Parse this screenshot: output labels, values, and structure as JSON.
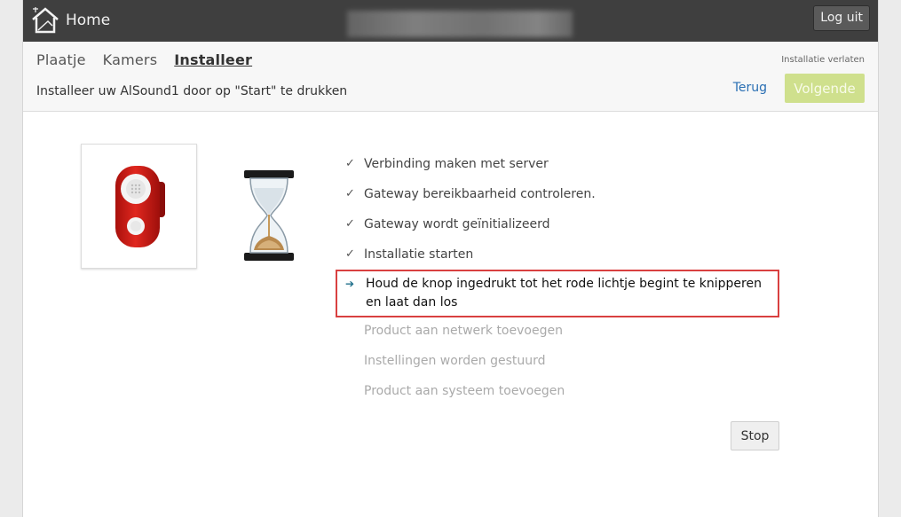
{
  "header": {
    "brand_label": "Home",
    "logout_label": "Log uit"
  },
  "nav": {
    "tabs": [
      {
        "label": "Plaatje",
        "active": false
      },
      {
        "label": "Kamers",
        "active": false
      },
      {
        "label": "Installeer",
        "active": true
      }
    ],
    "leave_label": "Installatie verlaten"
  },
  "wizard": {
    "instruction": "Installeer uw AlSound1 door op \"Start\" te drukken",
    "back_label": "Terug",
    "next_label": "Volgende",
    "steps": [
      {
        "label": "Verbinding maken met server",
        "status": "done"
      },
      {
        "label": "Gateway bereikbaarheid controleren.",
        "status": "done"
      },
      {
        "label": "Gateway wordt geïnitializeerd",
        "status": "done"
      },
      {
        "label": "Installatie starten",
        "status": "done"
      },
      {
        "label": "Houd de knop ingedrukt tot het rode lichtje begint te knipperen en laat dan los",
        "status": "current"
      },
      {
        "label": "Product aan netwerk toevoegen",
        "status": "pending"
      },
      {
        "label": "Instellingen worden gestuurd",
        "status": "pending"
      },
      {
        "label": "Product aan systeem toevoegen",
        "status": "pending"
      }
    ],
    "done_mark": "✓",
    "current_mark": "➔",
    "stop_label": "Stop"
  },
  "colors": {
    "topbar": "#3f3f3f",
    "next_button": "#cfe08d",
    "link": "#2a6fb3",
    "highlight_border": "#d94040",
    "product_red": "#d3201c"
  }
}
